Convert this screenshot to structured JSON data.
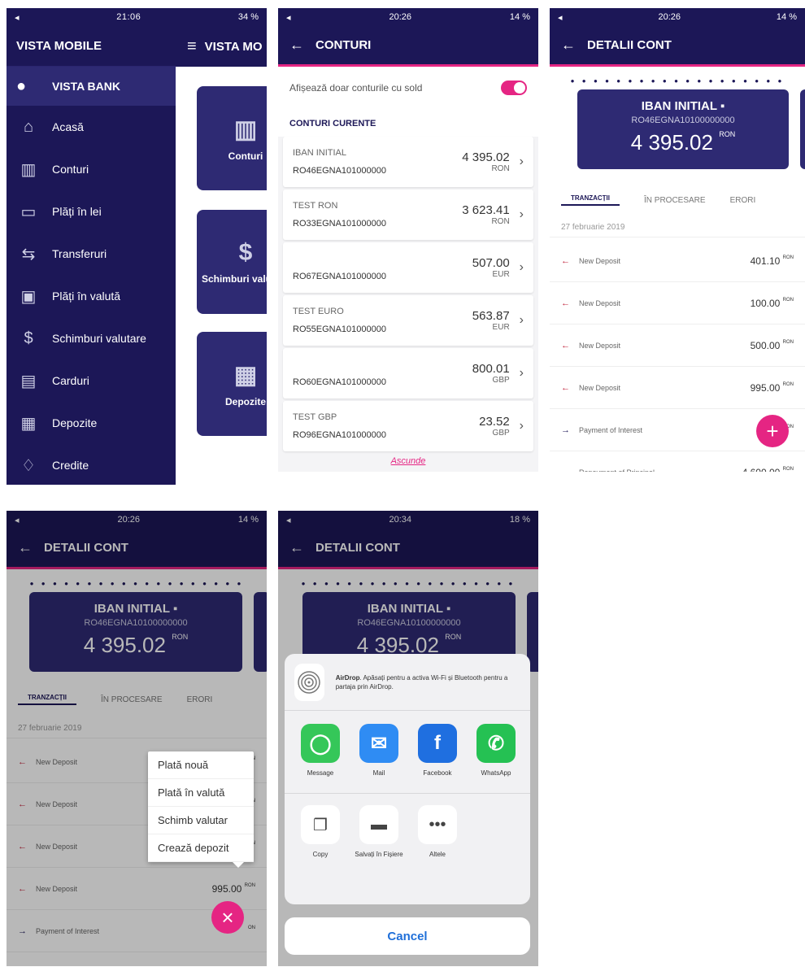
{
  "p1": {
    "status": {
      "time": "21:06",
      "battery": "34 %"
    },
    "drawer": {
      "title": "VISTA MOBILE",
      "bank": "VISTA BANK",
      "items": [
        {
          "icon": "home-icon",
          "label": "Acasă"
        },
        {
          "icon": "bank-icon",
          "label": "Conturi"
        },
        {
          "icon": "payment-icon",
          "label": "Plăți în lei"
        },
        {
          "icon": "transfer-icon",
          "label": "Transferuri"
        },
        {
          "icon": "cash-icon",
          "label": "Plăți în valută"
        },
        {
          "icon": "exchange-icon",
          "label": "Schimburi valutare"
        },
        {
          "icon": "card-icon",
          "label": "Carduri"
        },
        {
          "icon": "safe-icon",
          "label": "Depozite"
        },
        {
          "icon": "credit-icon",
          "label": "Credite"
        }
      ]
    },
    "main": {
      "title": "VISTA MO",
      "tiles": [
        "Conturi",
        "Schimburi valutare",
        "Depozite"
      ]
    }
  },
  "p2": {
    "status": {
      "time": "20:26",
      "battery": "14 %"
    },
    "title": "CONTURI",
    "toggle_label": "Afișează doar conturile cu sold",
    "section": "CONTURI CURENTE",
    "accounts": [
      {
        "name": "IBAN INITIAL",
        "iban": "RO46EGNA101000000",
        "amount": "4 395.02",
        "currency": "RON"
      },
      {
        "name": "TEST RON",
        "iban": "RO33EGNA101000000",
        "amount": "3 623.41",
        "currency": "RON"
      },
      {
        "name": "",
        "iban": "RO67EGNA101000000",
        "amount": "507.00",
        "currency": "EUR"
      },
      {
        "name": "TEST EURO",
        "iban": "RO55EGNA101000000",
        "amount": "563.87",
        "currency": "EUR"
      },
      {
        "name": "",
        "iban": "RO60EGNA101000000",
        "amount": "800.01",
        "currency": "GBP"
      },
      {
        "name": "TEST GBP",
        "iban": "RO96EGNA101000000",
        "amount": "23.52",
        "currency": "GBP"
      }
    ],
    "hide_link": "Ascunde"
  },
  "detail": {
    "title": "DETALII CONT",
    "card": {
      "name": "IBAN INITIAL",
      "iban": "RO46EGNA10100000000",
      "amount": "4 395.02",
      "currency": "RON"
    },
    "tabs": [
      "TRANZACȚII",
      "ÎN PROCESARE",
      "ERORI"
    ],
    "date": "27 februarie 2019",
    "transactions": [
      {
        "desc": "New Deposit",
        "amount": "401.10",
        "currency": "RON",
        "dir": "in"
      },
      {
        "desc": "New Deposit",
        "amount": "100.00",
        "currency": "RON",
        "dir": "in"
      },
      {
        "desc": "New Deposit",
        "amount": "500.00",
        "currency": "RON",
        "dir": "in"
      },
      {
        "desc": "New Deposit",
        "amount": "995.00",
        "currency": "RON",
        "dir": "in"
      },
      {
        "desc": "Payment of Interest",
        "amount": "",
        "currency": "ON",
        "dir": "out"
      },
      {
        "desc": "Repayment of Principal",
        "amount": "4 600.00",
        "currency": "RON",
        "dir": "out"
      }
    ]
  },
  "p3": {
    "status": {
      "time": "20:26",
      "battery": "14 %"
    }
  },
  "p4": {
    "status": {
      "time": "20:26",
      "battery": "14 %"
    },
    "menu": [
      "Plată nouă",
      "Plată în valută",
      "Schimb valutar",
      "Crează depozit"
    ]
  },
  "p5": {
    "status": {
      "time": "20:34",
      "battery": "18 %"
    },
    "airdrop": {
      "title": "AirDrop",
      "text": ". Apăsați pentru a activa Wi-Fi și Bluetooth pentru a partaja prin AirDrop."
    },
    "apps": [
      {
        "label": "Message",
        "color": "#35c759",
        "icon": "message-icon"
      },
      {
        "label": "Mail",
        "color": "#2f8cf3",
        "icon": "mail-icon"
      },
      {
        "label": "Facebook",
        "color": "#1f6fe0",
        "icon": "facebook-icon"
      },
      {
        "label": "WhatsApp",
        "color": "#25c153",
        "icon": "whatsapp-icon"
      }
    ],
    "actions": [
      {
        "label": "Copy",
        "icon": "copy-icon"
      },
      {
        "label": "Salvați în Fișiere",
        "icon": "folder-icon"
      },
      {
        "label": "Altele",
        "icon": "more-icon"
      }
    ],
    "cancel": "Cancel"
  }
}
